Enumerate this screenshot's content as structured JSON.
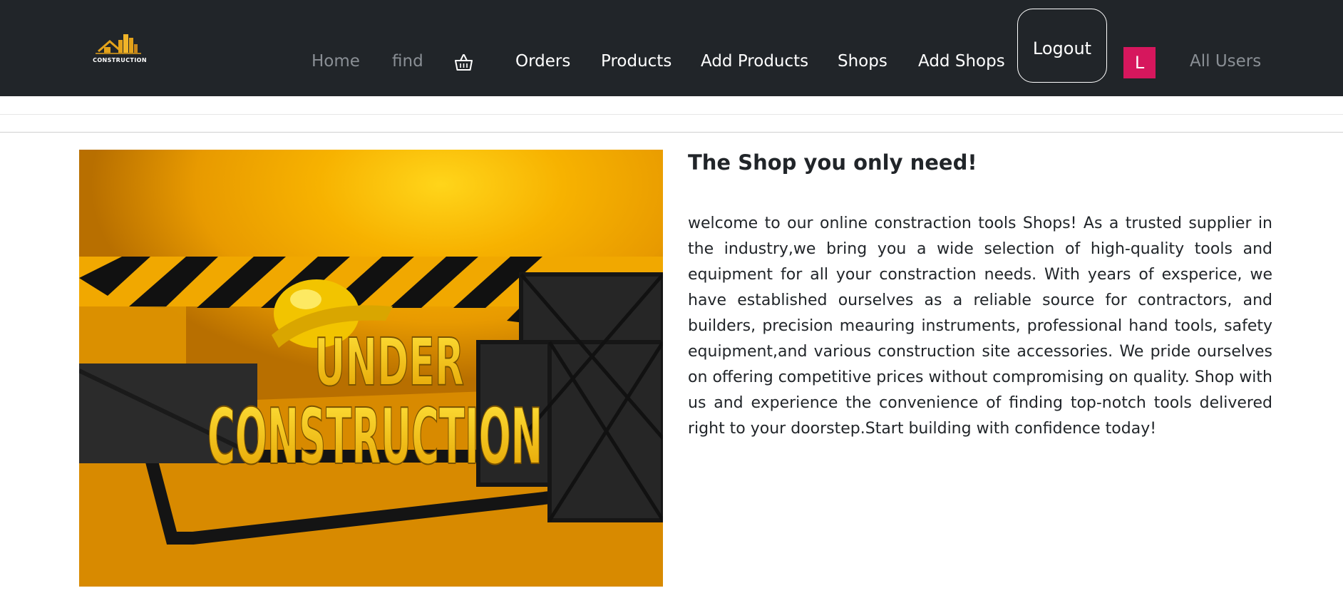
{
  "brand": {
    "logo_text": "CONSTRUCTION"
  },
  "nav": {
    "home": "Home",
    "find": "find",
    "cart_icon": "basket-icon",
    "orders": "Orders",
    "products": "Products",
    "add_products": "Add Products",
    "shops": "Shops",
    "add_shops": "Add Shops",
    "logout": "Logout",
    "avatar_initial": "L",
    "all_users": "All Users"
  },
  "main": {
    "image_text_top": "UNDER",
    "image_text_bottom": "CONSTRUCTION",
    "headline": "The Shop you only need!",
    "description": "welcome to our online constraction tools Shops! As a trusted supplier in the industry,we bring you a wide selection of high-quality tools and equipment for all your constraction needs. With years of exsperice, we have established ourselves as a reliable source for contractors, and builders, precision meauring instruments, professional hand tools, safety equipment,and various construction site accessories. We pride ourselves on offering competitive prices without compromising on quality. Shop with us and experience the convenience of finding top-notch tools delivered right to your doorstep.Start building with confidence today!"
  },
  "colors": {
    "navbar_bg": "#212529",
    "avatar_bg": "#d6175d",
    "muted_link": "#8a8f95",
    "accent_yellow": "#f7b200"
  }
}
